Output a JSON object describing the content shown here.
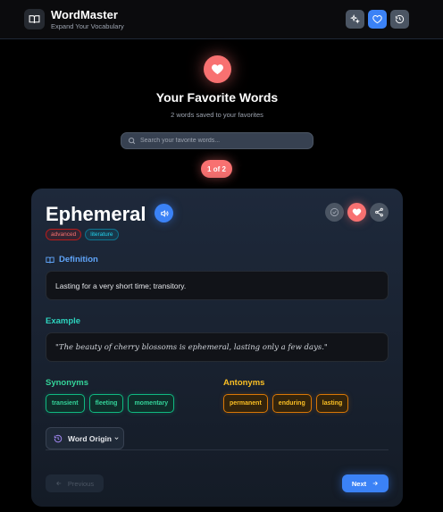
{
  "header": {
    "title": "WordMaster",
    "subtitle": "Expand Your Vocabulary",
    "buttons": [
      {
        "icon": "sparkles-icon",
        "active": false
      },
      {
        "icon": "heart-icon",
        "active": true
      },
      {
        "icon": "history-icon",
        "active": false
      }
    ]
  },
  "hero": {
    "icon": "heart-icon",
    "title": "Your Favorite Words",
    "subtitle": "2 words saved to your favorites"
  },
  "search": {
    "placeholder": "Search your favorite words...",
    "value": ""
  },
  "pagination": {
    "counter": "1 of 2"
  },
  "card": {
    "word": "Ephemeral",
    "tags": [
      "advanced",
      "literature"
    ],
    "definition_label": "Definition",
    "definition": "Lasting for a very short time; transitory.",
    "example_label": "Example",
    "example": "\"The beauty of cherry blossoms is ephemeral, lasting only a few days.\"",
    "synonyms_label": "Synonyms",
    "synonyms": [
      "transient",
      "fleeting",
      "momentary"
    ],
    "antonyms_label": "Antonyms",
    "antonyms": [
      "permanent",
      "enduring",
      "lasting"
    ],
    "origin_label": "Word Origin",
    "prev_label": "Previous",
    "next_label": "Next"
  },
  "colors": {
    "accent_blue": "#3b82f6",
    "favorite_red": "#f87171",
    "synonym_green": "#34d399",
    "antonym_amber": "#fbbf24",
    "example_teal": "#2dd4bf"
  }
}
